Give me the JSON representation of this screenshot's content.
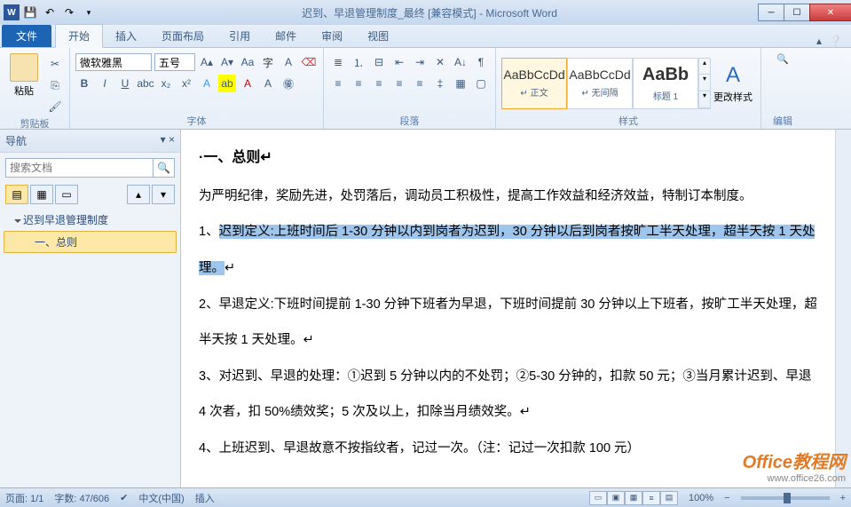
{
  "titlebar": {
    "title": "迟到、早退管理制度_最终 [兼容模式] - Microsoft Word"
  },
  "tabs": {
    "file": "文件",
    "list": [
      "开始",
      "插入",
      "页面布局",
      "引用",
      "邮件",
      "审阅",
      "视图"
    ],
    "active": "开始"
  },
  "ribbon": {
    "clipboard": {
      "label": "剪贴板",
      "paste": "粘贴"
    },
    "font": {
      "label": "字体",
      "name": "微软雅黑",
      "size": "五号"
    },
    "para": {
      "label": "段落"
    },
    "styles": {
      "label": "样式",
      "items": [
        {
          "preview": "AaBbCcDd",
          "name": "↵ 正文"
        },
        {
          "preview": "AaBbCcDd",
          "name": "↵ 无间隔"
        },
        {
          "preview": "AaBb",
          "name": "标题 1"
        }
      ],
      "change": "更改样式"
    },
    "editing": {
      "label": "编辑"
    }
  },
  "nav": {
    "title": "导航",
    "search_placeholder": "搜索文档",
    "tree": {
      "root": "迟到早退管理制度",
      "child": "一、总则"
    }
  },
  "document": {
    "heading_fragment": "一、总则",
    "p1": "为严明纪律，奖励先进，处罚落后，调动员工积极性，提高工作效益和经济效益，特制订本制度。",
    "p2_prefix": "1、",
    "p2_sel": "迟到定义:上班时间后 1-30 分钟以内到岗者为迟到，30 分钟以后到岗者按旷工半天处理，超半天按 1 天处",
    "p2_suffix_sel": "理。",
    "p3": "2、早退定义:下班时间提前 1-30 分钟下班者为早退，下班时间提前 30 分钟以上下班者，按旷工半天处理，超",
    "p3b": "半天按 1 天处理。",
    "p4": "3、对迟到、早退的处理：①迟到 5 分钟以内的不处罚；②5-30 分钟的，扣款 50 元；③当月累计迟到、早退",
    "p4b": "4 次者，扣 50%绩效奖；5 次及以上，扣除当月绩效奖。",
    "p5": "4、上班迟到、早退故意不按指纹者，记过一次。（注：记过一次扣款 100 元）"
  },
  "statusbar": {
    "page": "页面: 1/1",
    "words": "字数: 47/606",
    "lang": "中文(中国)",
    "mode": "插入",
    "zoom": "100%"
  },
  "watermark": {
    "brand": "Office教程网",
    "url": "www.office26.com"
  }
}
